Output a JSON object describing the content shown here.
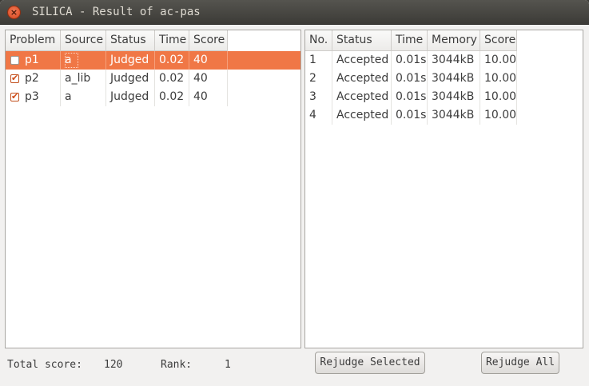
{
  "window": {
    "title": "SILICA - Result of ac-pas",
    "close_glyph": "×"
  },
  "problems": {
    "columns": [
      "Problem",
      "Source",
      "Status",
      "Time",
      "Score"
    ],
    "rows": [
      {
        "checked": false,
        "problem": "p1",
        "source": "a",
        "status": "Judged",
        "time": "0.02",
        "score": "40",
        "selected": true
      },
      {
        "checked": true,
        "problem": "p2",
        "source": "a_lib",
        "status": "Judged",
        "time": "0.02",
        "score": "40",
        "selected": false
      },
      {
        "checked": true,
        "problem": "p3",
        "source": "a",
        "status": "Judged",
        "time": "0.02",
        "score": "40",
        "selected": false
      }
    ]
  },
  "tests": {
    "columns": [
      "No.",
      "Status",
      "Time",
      "Memory",
      "Score"
    ],
    "rows": [
      {
        "no": "1",
        "status": "Accepted",
        "time": "0.01s",
        "memory": "3044kB",
        "score": "10.00"
      },
      {
        "no": "2",
        "status": "Accepted",
        "time": "0.01s",
        "memory": "3044kB",
        "score": "10.00"
      },
      {
        "no": "3",
        "status": "Accepted",
        "time": "0.01s",
        "memory": "3044kB",
        "score": "10.00"
      },
      {
        "no": "4",
        "status": "Accepted",
        "time": "0.01s",
        "memory": "3044kB",
        "score": "10.00"
      }
    ]
  },
  "footer": {
    "total_label": "Total score:",
    "total_value": "120",
    "rank_label": "Rank:",
    "rank_value": "1",
    "rejudge_selected": "Rejudge Selected",
    "rejudge_all": "Rejudge All"
  },
  "colors": {
    "selection": "#f07746",
    "titlebar": "#3c3b37",
    "close": "#e0562a"
  }
}
